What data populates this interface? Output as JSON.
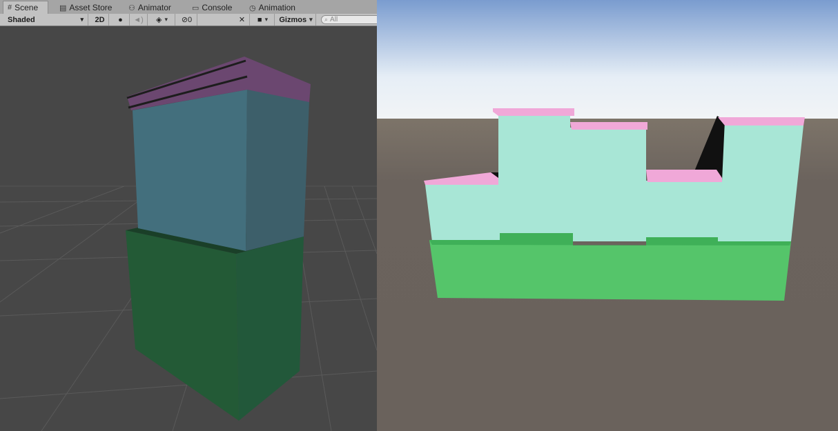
{
  "tabs": [
    {
      "label": "Scene",
      "icon": "grid-icon",
      "active": true
    },
    {
      "label": "Asset Store",
      "icon": "store-icon",
      "active": false
    },
    {
      "label": "Animator",
      "icon": "animator-icon",
      "active": false
    },
    {
      "label": "Console",
      "icon": "console-icon",
      "active": false
    },
    {
      "label": "Animation",
      "icon": "clock-icon",
      "active": false
    }
  ],
  "toolbar": {
    "shading_mode": "Shaded",
    "mode_2d": "2D",
    "hidden_count": "0",
    "gizmos": "Gizmos",
    "search_placeholder": "All"
  },
  "colors": {
    "editor_bg": "#474747",
    "block_pink": "#f0a8d8",
    "block_cyan": "#a8e6d6",
    "block_green": "#55c56a",
    "sky_top": "#7fa3d4",
    "ground": "#6b635d"
  }
}
